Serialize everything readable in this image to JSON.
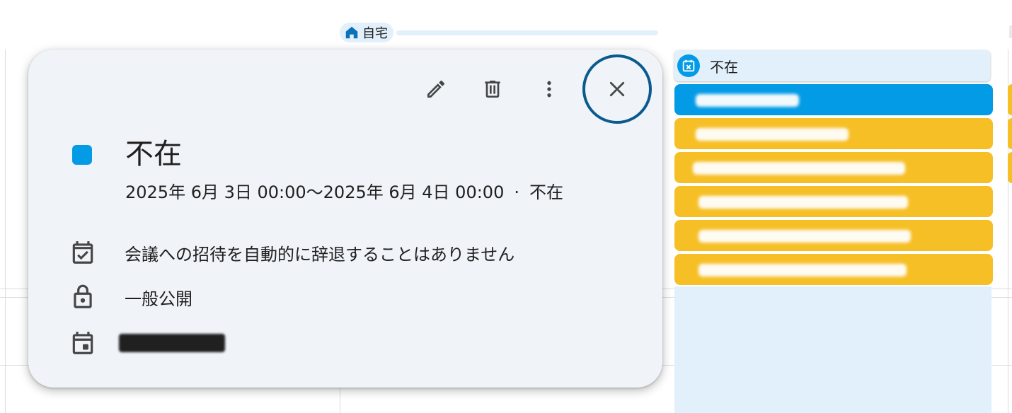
{
  "location_chip": {
    "label": "自宅",
    "icon": "home-icon"
  },
  "right_column": {
    "ooo_chip": {
      "label": "不在",
      "icon": "calendar-close-icon"
    },
    "colors": {
      "blue": "#039be5",
      "yellow": "#f6bf26",
      "shade": "#e1f0fb"
    }
  },
  "popover": {
    "toolbar": {
      "edit_icon": "pencil-icon",
      "delete_icon": "trash-icon",
      "more_icon": "more-vert-icon",
      "close_icon": "close-icon"
    },
    "color": "#039be5",
    "title": "不在",
    "datetime": "2025年 6月 3日 00:00～2025年 6月 4日 00:00",
    "separator": "·",
    "type": "不在",
    "auto_decline": "会議への招待を自動的に辞退することはありません",
    "visibility": "一般公開",
    "icons": {
      "auto_decline": "event-available-icon",
      "visibility": "lock-icon",
      "calendar": "calendar-event-icon"
    }
  }
}
